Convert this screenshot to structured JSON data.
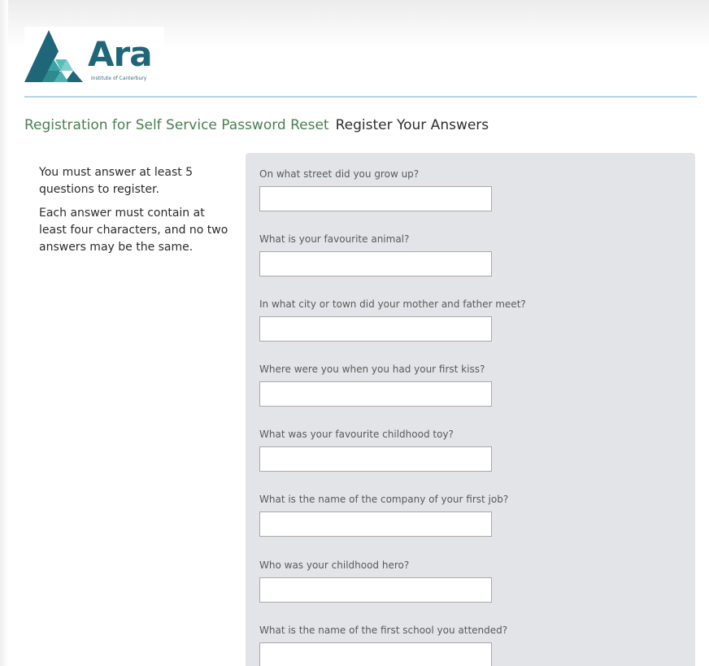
{
  "logo": {
    "word": "Ara",
    "subtitle": "Institute of Canterbury"
  },
  "breadcrumb": {
    "section": "Registration for Self Service Password Reset",
    "page": "Register Your Answers"
  },
  "instructions": {
    "line1": "You must answer at least 5 questions to register.",
    "line2": "Each answer must contain at least four characters, and no two answers may be the same."
  },
  "questions": [
    {
      "label": "On what street did you grow up?",
      "value": ""
    },
    {
      "label": "What is your favourite animal?",
      "value": ""
    },
    {
      "label": "In what city or town did your mother and father meet?",
      "value": ""
    },
    {
      "label": "Where were you when you had your first kiss?",
      "value": ""
    },
    {
      "label": "What was your favourite childhood toy?",
      "value": ""
    },
    {
      "label": "What is the name of the company of your first job?",
      "value": ""
    },
    {
      "label": "Who was your childhood hero?",
      "value": ""
    },
    {
      "label": "What is the name of the first school you attended?",
      "value": ""
    }
  ],
  "colors": {
    "brand_teal": "#1e6678",
    "breadcrumb_green": "#4a7f4e",
    "panel_grey": "#e3e4e7",
    "rule_blue": "#b3d3e6"
  }
}
